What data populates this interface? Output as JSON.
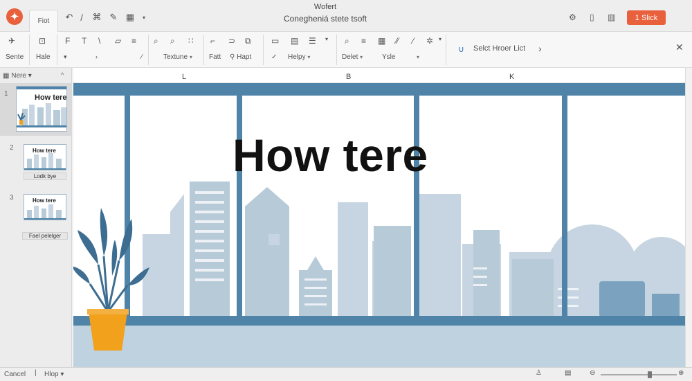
{
  "titlebar": {
    "app_title": "Wofert",
    "doc_title": "Conegheniá stete tsoft",
    "file_tab": "Fiot",
    "share_label": "1 Slick"
  },
  "ribbon": {
    "labels": {
      "send": "Sente",
      "hale": "Hale",
      "textune": "Textune",
      "fatt": "Fatt",
      "hapt": "Hapt",
      "helpy": "Helpy",
      "delet": "Delet",
      "ysle": "Ysle",
      "select": "Selct Hroer Lict"
    }
  },
  "panel": {
    "header": "Nere",
    "thumbs": [
      {
        "num": "1",
        "title": "How tere"
      },
      {
        "num": "2",
        "title": "How tere",
        "caption": "Lodk bye"
      },
      {
        "num": "3",
        "title": "How tere",
        "caption": "Fael pelelger"
      }
    ]
  },
  "ruler": {
    "marks": [
      "L",
      "B",
      "K"
    ]
  },
  "slide": {
    "title": "How tere"
  },
  "statusbar": {
    "left": "Cancel",
    "hlop": "Hlop"
  },
  "colors": {
    "accent": "#e8603c",
    "frame": "#4f84a8",
    "building": "#b7cad8",
    "building_light": "#c6d5e1",
    "floor": "#bfd2df",
    "pot": "#f2a11d",
    "leaf": "#3d6e92"
  }
}
